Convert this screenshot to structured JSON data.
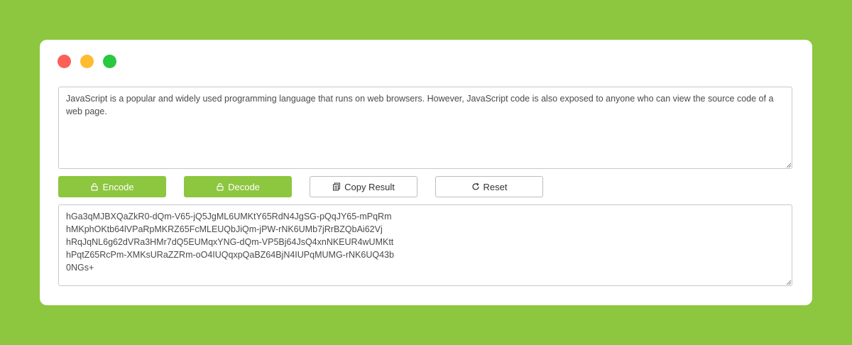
{
  "window": {
    "controls": [
      "close",
      "minimize",
      "maximize"
    ]
  },
  "input": {
    "text": "JavaScript is a popular and widely used programming language that runs on web browsers. However, JavaScript code is also exposed to anyone who can view the source code of a web page."
  },
  "toolbar": {
    "encode_label": "Encode",
    "decode_label": "Decode",
    "copy_label": "Copy Result",
    "reset_label": "Reset",
    "encode_icon": "lock-icon",
    "decode_icon": "lock-icon",
    "copy_icon": "copy-icon",
    "reset_icon": "refresh-icon"
  },
  "output": {
    "text": "hGa3qMJBXQaZkR0-dQm-V65-jQ5JgML6UMKtY65RdN4JgSG-pQqJY65-mPqRm\nhMKphOKtb64lVPaRpMKRZ65FcMLEUQbJiQm-jPW-rNK6UMb7jRrBZQbAi62Vj\nhRqJqNL6g62dVRa3HMr7dQ5EUMqxYNG-dQm-VP5Bj64JsQ4xnNKEUR4wUMKtt\nhPqtZ65RcPm-XMKsURaZZRm-oO4IUQqxpQaBZ64BjN4IUPqMUMG-rNK6UQ43b\n0NGs+"
  },
  "colors": {
    "accent": "#8dc63f",
    "close": "#fe5f57",
    "minimize": "#febc2e",
    "maximize": "#28c840"
  }
}
